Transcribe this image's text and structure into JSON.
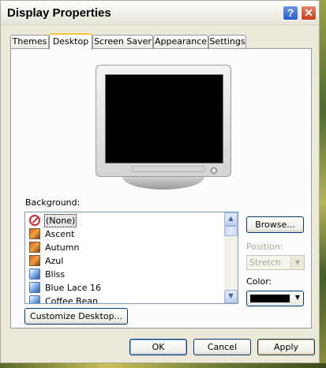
{
  "window": {
    "title": "Display Properties"
  },
  "title_buttons": {
    "help": "?",
    "close": "✕"
  },
  "tabs": [
    {
      "label": "Themes"
    },
    {
      "label": "Desktop"
    },
    {
      "label": "Screen Saver"
    },
    {
      "label": "Appearance"
    },
    {
      "label": "Settings"
    }
  ],
  "active_tab": "Desktop",
  "background": {
    "label": "Background:",
    "items": [
      {
        "label": "(None)",
        "icon": "none-icon",
        "selected": true
      },
      {
        "label": "Ascent",
        "icon": "image-file-icon"
      },
      {
        "label": "Autumn",
        "icon": "image-file-icon"
      },
      {
        "label": "Azul",
        "icon": "image-file-icon"
      },
      {
        "label": "Bliss",
        "icon": "brush-image-icon"
      },
      {
        "label": "Blue Lace 16",
        "icon": "brush-image-icon"
      },
      {
        "label": "Coffee Bean",
        "icon": "brush-image-icon"
      }
    ],
    "scroll_up": "▲",
    "scroll_down": "▼"
  },
  "browse_label": "Browse...",
  "position": {
    "label": "Position:",
    "value": "Stretch",
    "arrow": "▼"
  },
  "color": {
    "label": "Color:",
    "value": "#000000",
    "arrow": "▼"
  },
  "customize_label": "Customize Desktop...",
  "footer": {
    "ok": "OK",
    "cancel": "Cancel",
    "apply": "Apply"
  }
}
